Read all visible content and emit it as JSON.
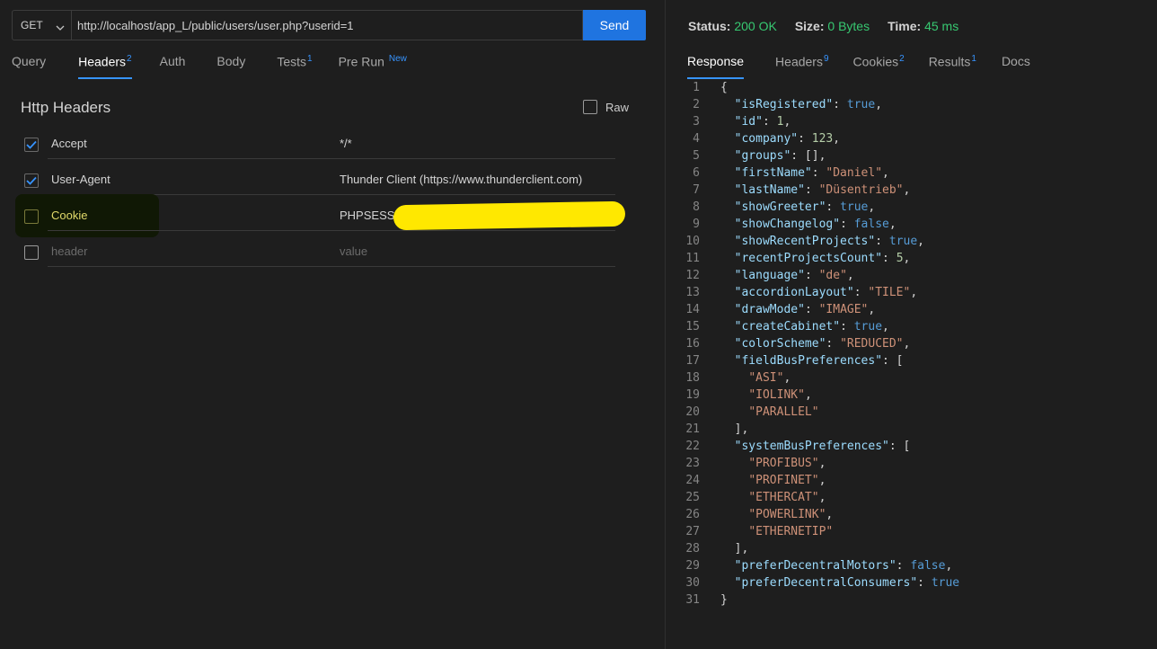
{
  "request": {
    "method": "GET",
    "url": "http://localhost/app_L/public/users/user.php?userid=1",
    "send_label": "Send",
    "tabs": [
      {
        "label": "Query",
        "badge": ""
      },
      {
        "label": "Headers",
        "badge": "2"
      },
      {
        "label": "Auth",
        "badge": ""
      },
      {
        "label": "Body",
        "badge": ""
      },
      {
        "label": "Tests",
        "badge": "1"
      },
      {
        "label": "Pre Run",
        "badge": "New"
      }
    ],
    "active_tab": "Headers",
    "section_title": "Http Headers",
    "raw_label": "Raw",
    "headers": [
      {
        "checked": true,
        "key": "Accept",
        "value": "*/*"
      },
      {
        "checked": true,
        "key": "User-Agent",
        "value": "Thunder Client (https://www.thunderclient.com)"
      },
      {
        "checked": false,
        "key": "Cookie",
        "value": "PHPSESSID"
      }
    ],
    "new_header": {
      "key_placeholder": "header",
      "value_placeholder": "value"
    }
  },
  "response": {
    "status_label": "Status:",
    "status_value": "200 OK",
    "size_label": "Size:",
    "size_value": "0 Bytes",
    "time_label": "Time:",
    "time_value": "45 ms",
    "tabs": [
      {
        "label": "Response",
        "badge": ""
      },
      {
        "label": "Headers",
        "badge": "9"
      },
      {
        "label": "Cookies",
        "badge": "2"
      },
      {
        "label": "Results",
        "badge": "1"
      },
      {
        "label": "Docs",
        "badge": ""
      }
    ],
    "active_tab": "Response",
    "lines": [
      "{",
      "  \"isRegistered\": true,",
      "  \"id\": 1,",
      "  \"company\": 123,",
      "  \"groups\": [],",
      "  \"firstName\": \"Daniel\",",
      "  \"lastName\": \"Düsentrieb\",",
      "  \"showGreeter\": true,",
      "  \"showChangelog\": false,",
      "  \"showRecentProjects\": true,",
      "  \"recentProjectsCount\": 5,",
      "  \"language\": \"de\",",
      "  \"accordionLayout\": \"TILE\",",
      "  \"drawMode\": \"IMAGE\",",
      "  \"createCabinet\": true,",
      "  \"colorScheme\": \"REDUCED\",",
      "  \"fieldBusPreferences\": [",
      "    \"ASI\",",
      "    \"IOLINK\",",
      "    \"PARALLEL\"",
      "  ],",
      "  \"systemBusPreferences\": [",
      "    \"PROFIBUS\",",
      "    \"PROFINET\",",
      "    \"ETHERCAT\",",
      "    \"POWERLINK\",",
      "    \"ETHERNETIP\"",
      "  ],",
      "  \"preferDecentralMotors\": false,",
      "  \"preferDecentralConsumers\": true",
      "}"
    ]
  },
  "colors": {
    "accent": "#1f74e0",
    "status_ok": "#37c871",
    "json_key": "#9cdcfe",
    "json_string": "#ce9178",
    "json_number": "#b5cea8",
    "json_bool": "#569cd6"
  },
  "icons": [
    "chevron-down-icon",
    "checkbox-checked-icon",
    "checkbox-empty-icon"
  ]
}
